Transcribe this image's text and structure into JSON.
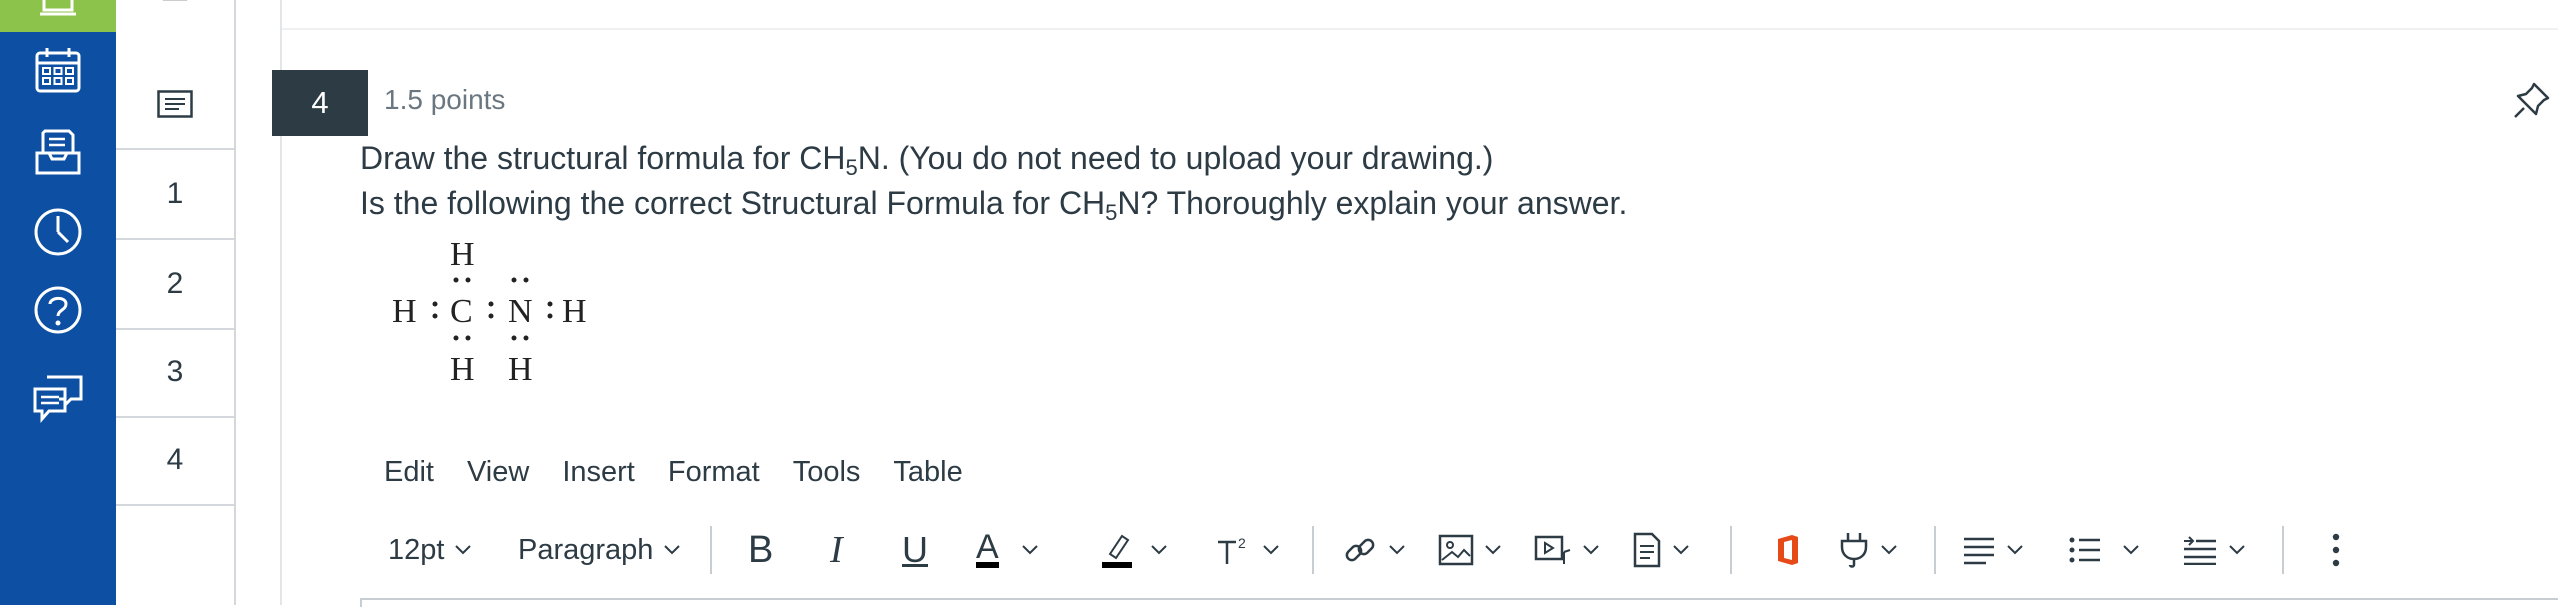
{
  "question": {
    "number": "4",
    "points": "1.5 points",
    "line1_pre": "Draw the structural formula for CH",
    "line1_sub": "5",
    "line1_post": "N. (You do not need to upload your drawing.)",
    "line2_pre": "Is the following the correct Structural Formula for CH",
    "line2_sub": "5",
    "line2_post": "N?   Thoroughly explain your answer."
  },
  "lewis_structure": {
    "atoms": [
      "H",
      "C",
      "N",
      "H",
      "H",
      "H",
      "H"
    ]
  },
  "question_nav": {
    "items": [
      "1",
      "2",
      "3",
      "4"
    ]
  },
  "global_nav": {
    "icons": [
      "courses-icon",
      "calendar-icon",
      "inbox-icon",
      "history-icon",
      "help-icon",
      "commons-icon"
    ]
  },
  "editor": {
    "menubar": [
      "Edit",
      "View",
      "Insert",
      "Format",
      "Tools",
      "Table"
    ],
    "font_size": "12pt",
    "block_format": "Paragraph",
    "toolbar_icons": [
      "bold-icon",
      "italic-icon",
      "underline-icon",
      "text-color-icon",
      "highlight-icon",
      "superscript-icon",
      "link-icon",
      "image-icon",
      "media-icon",
      "document-icon",
      "office-icon",
      "plugin-icon",
      "align-icon",
      "list-icon",
      "indent-icon",
      "more-icon"
    ],
    "bold_glyph": "B",
    "italic_glyph": "I",
    "underline_glyph": "U",
    "text_color_glyph": "A"
  },
  "colors": {
    "global_nav": "#0d4fa2",
    "active_green": "#8cc34a",
    "question_badge": "#2d3b45",
    "office_orange": "#e64a19"
  }
}
